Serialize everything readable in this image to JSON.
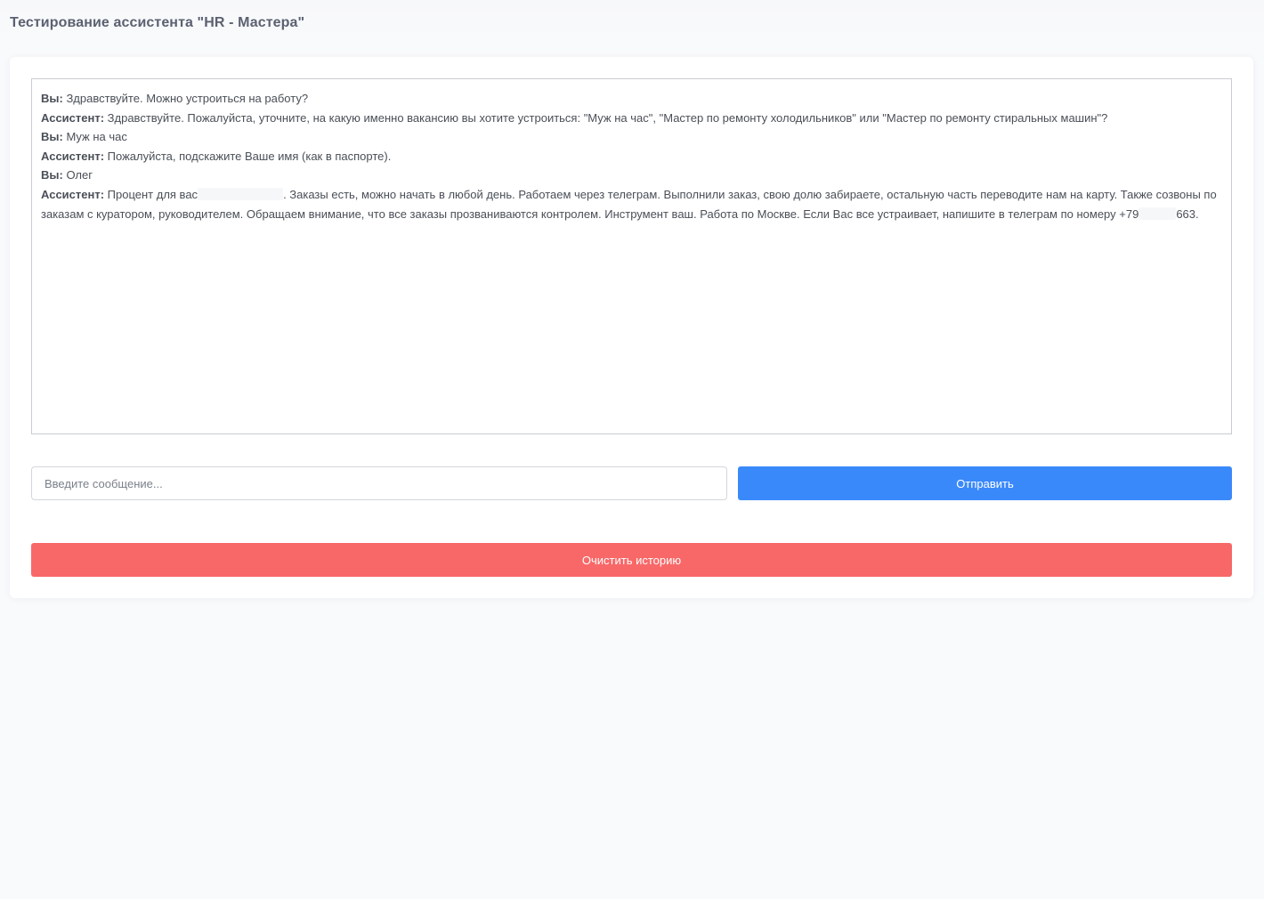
{
  "header": {
    "title": "Тестирование ассистента \"HR - Мастера\""
  },
  "chat": {
    "messages": [
      {
        "speaker": "Вы:",
        "text": " Здравствуйте. Можно устроиться на работу?"
      },
      {
        "speaker": "Ассистент:",
        "text": " Здравствуйте. Пожалуйста, уточните, на какую именно вакансию вы хотите устроиться: \"Муж на час\", \"Мастер по ремонту холодильников\" или \"Мастер по ремонту стиральных машин\"?"
      },
      {
        "speaker": "Вы:",
        "text": " Муж на час"
      },
      {
        "speaker": "Ассистент:",
        "text": " Пожалуйста, подскажите Ваше имя (как в паспорте)."
      },
      {
        "speaker": "Вы:",
        "text": " Олег"
      },
      {
        "speaker": "Ассистент:",
        "text_part1": " Процент для вас",
        "text_part2": ". Заказы есть, можно начать в любой день. Работаем через телеграм. Выполнили заказ, свою долю забираете, остальную часть переводите нам на карту. Также созвоны по заказам с куратором, руководителем. Обращаем внимание, что все заказы прозваниваются контролем. Инструмент ваш. Работа по Москве. Если Вас все устраивает, напишите в телеграм по номеру +79",
        "text_part3": "663."
      }
    ]
  },
  "composer": {
    "placeholder": "Введите сообщение...",
    "value": "",
    "send_label": "Отправить"
  },
  "actions": {
    "clear_label": "Очистить историю"
  },
  "colors": {
    "send_button": "#3a89fb",
    "clear_button": "#f86868",
    "page_background": "#f9fafc"
  }
}
